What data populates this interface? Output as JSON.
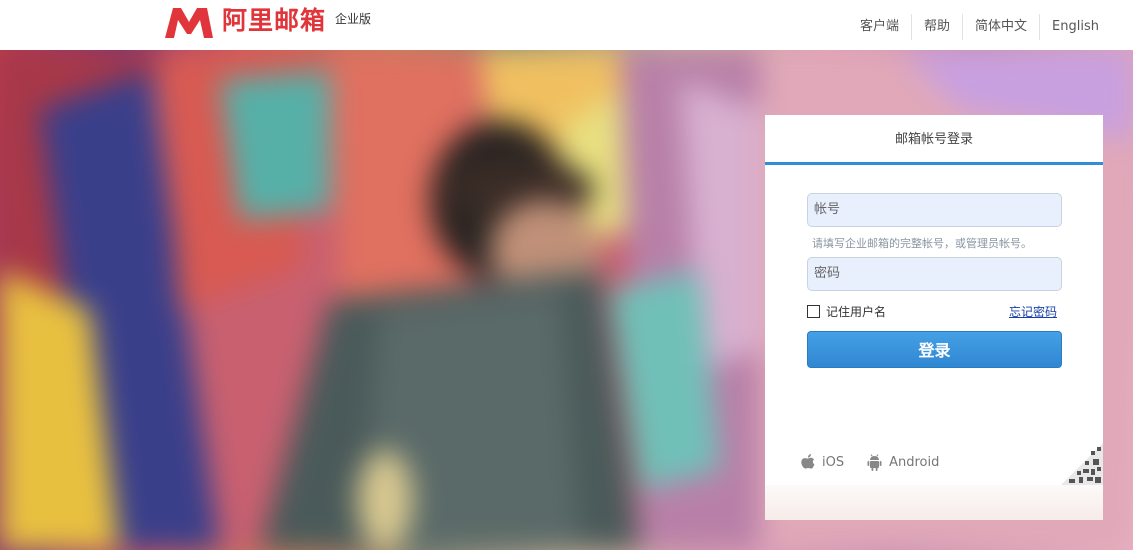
{
  "header": {
    "brand_name": "阿里邮箱",
    "edition": "企业版",
    "nav": [
      "客户端",
      "帮助",
      "简体中文",
      "English"
    ]
  },
  "login": {
    "title": "邮箱帐号登录",
    "account_placeholder": "帐号",
    "account_hint": "请填写企业邮箱的完整帐号，或管理员帐号。",
    "password_placeholder": "密码",
    "remember_label": "记住用户名",
    "forgot_label": "忘记密码",
    "submit_label": "登录",
    "apps": [
      {
        "label": "iOS",
        "icon": "apple-icon"
      },
      {
        "label": "Android",
        "icon": "android-icon"
      }
    ]
  },
  "colors": {
    "brand_red": "#e0353a",
    "accent_blue": "#2e8edb"
  }
}
